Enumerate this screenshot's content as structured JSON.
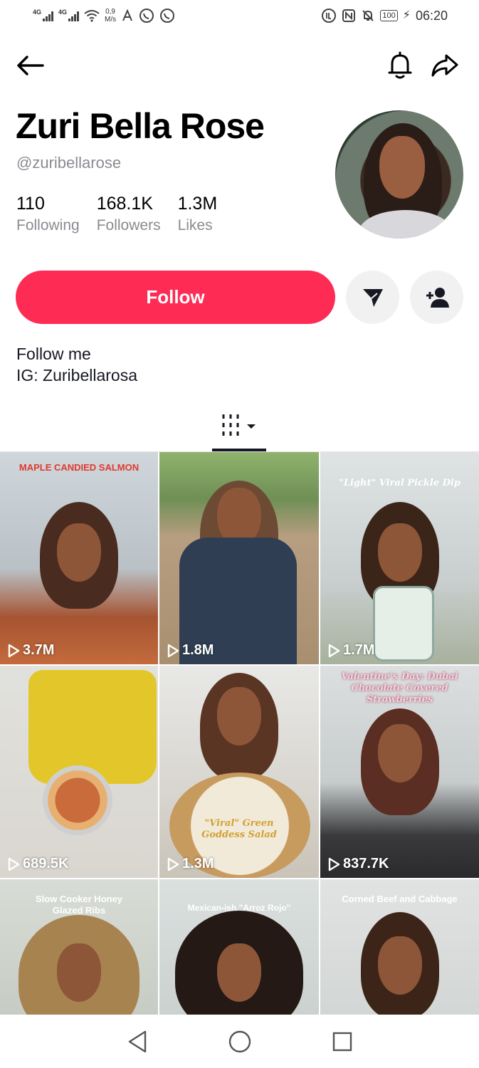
{
  "status_bar": {
    "sim1": "4G",
    "sim2": "4G",
    "speed_value": "0,9",
    "speed_unit": "M/s",
    "battery": "100",
    "time": "06:20"
  },
  "header": {
    "back_icon": "arrow-left-icon",
    "bell_icon": "bell-icon",
    "share_icon": "share-arrow-icon"
  },
  "profile": {
    "display_name": "Zuri Bella Rose",
    "username": "@zuribellarose",
    "stats": [
      {
        "value": "110",
        "label": "Following"
      },
      {
        "value": "168.1K",
        "label": "Followers"
      },
      {
        "value": "1.3M",
        "label": "Likes"
      }
    ],
    "bio_line1": "Follow me",
    "bio_line2": "IG: Zuribellarosa"
  },
  "actions": {
    "follow_label": "Follow",
    "message_icon": "paper-plane-icon",
    "add_friend_icon": "add-user-icon"
  },
  "tabs": {
    "active_icon": "video-grid-icon"
  },
  "videos": [
    {
      "caption": "MAPLE CANDIED SALMON",
      "views": "3.7M"
    },
    {
      "caption": "",
      "views": "1.8M"
    },
    {
      "caption": "\"Light\" Viral Pickle Dip",
      "views": "1.7M"
    },
    {
      "caption": "",
      "views": "689.5K"
    },
    {
      "caption": "\"Viral\" Green Goddess Salad",
      "views": "1.3M"
    },
    {
      "caption": "Valentine's Day: Dubai Chocolate Covered Strawberries",
      "views": "837.7K"
    },
    {
      "caption": "Slow Cooker Honey Glazed Ribs",
      "views": ""
    },
    {
      "caption": "Mexican-ish \"Arroz Rojo\"",
      "views": ""
    },
    {
      "caption": "Corned Beef and Cabbage",
      "views": ""
    }
  ],
  "colors": {
    "follow": "#fe2c55",
    "text_primary": "#161823",
    "text_secondary": "#8a8b91",
    "button_grey": "#f1f1f2"
  }
}
